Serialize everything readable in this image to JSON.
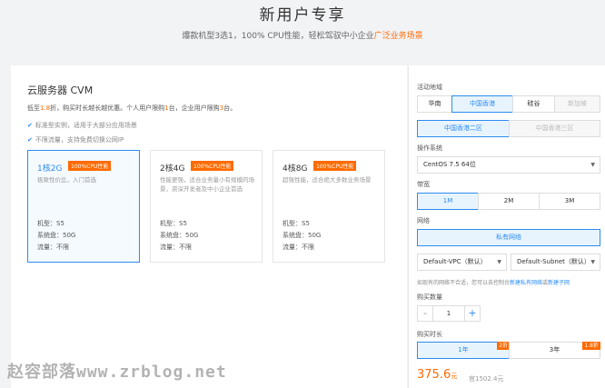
{
  "header": {
    "title": "新用户专享",
    "subtitle_main": "爆款机型3选1，100% CPU性能，轻松驾驭中小企业",
    "subtitle_highlight": "广泛业务场景"
  },
  "product": {
    "title": "云服务器 CVM",
    "promo_prefix": "低至",
    "promo_discount": "1.8",
    "promo_middle": "折，购买时长越长越优惠。个人用户限购",
    "promo_personal": "1",
    "promo_middle2": "台，企业用户限购",
    "promo_enterprise": "3",
    "promo_suffix": "台。",
    "features": [
      "标准型实例，适用于大部分应用场景",
      "不限流量，支持免费切换公网IP"
    ]
  },
  "cards": [
    {
      "spec": "1核2G",
      "badge": "100%CPU性能",
      "desc": "极致性价比，入门首选",
      "model": "机型：S5",
      "disk": "系统盘：50G",
      "traffic": "流量：不限"
    },
    {
      "spec": "2核4G",
      "badge": "100%CPU性能",
      "desc": "性能更强，适合业务量小有规模的场景，资深开发者及中小企业首选",
      "model": "机型：S5",
      "disk": "系统盘：50G",
      "traffic": "流量：不限"
    },
    {
      "spec": "4核8G",
      "badge": "100%CPU性能",
      "desc": "超强性能，适合绝大多数业务场景",
      "model": "机型：S5",
      "disk": "系统盘：50G",
      "traffic": "流量：不限"
    }
  ],
  "config": {
    "region_label": "活动地域",
    "regions": [
      "华南",
      "中国香港",
      "硅谷",
      "新加坡"
    ],
    "zones": [
      "中国香港二区",
      "中国香港三区"
    ],
    "os_label": "操作系统",
    "os_value": "CentOS 7.5 64位",
    "bandwidth_label": "带宽",
    "bandwidth_options": [
      "1M",
      "2M",
      "3M"
    ],
    "network_label": "网络",
    "network_type": "私有网络",
    "vpc_value": "Default-VPC（默认）",
    "subnet_value": "Default-Subnet（默认）",
    "network_note_prefix": "如现有的网络不合适，您可以去控制台",
    "network_note_link1": "新建私有网络",
    "network_note_or": "或",
    "network_note_link2": "新建子网",
    "quantity_label": "购买数量",
    "quantity_value": "1",
    "minus_symbol": "-",
    "plus_symbol": "+",
    "duration_label": "购买时长",
    "durations": [
      {
        "label": "1年",
        "badge": "2折"
      },
      {
        "label": "3年",
        "badge": "1.8折"
      }
    ],
    "price": "375.6",
    "price_unit": "元",
    "original_price": "官1502.4元"
  },
  "watermark": "赵容部落www.zrblog.net",
  "icons": {
    "check": "check-icon",
    "caret": "chevron-down-icon"
  },
  "colors": {
    "accent": "#2d8cf0",
    "promo": "#ff6a00"
  }
}
